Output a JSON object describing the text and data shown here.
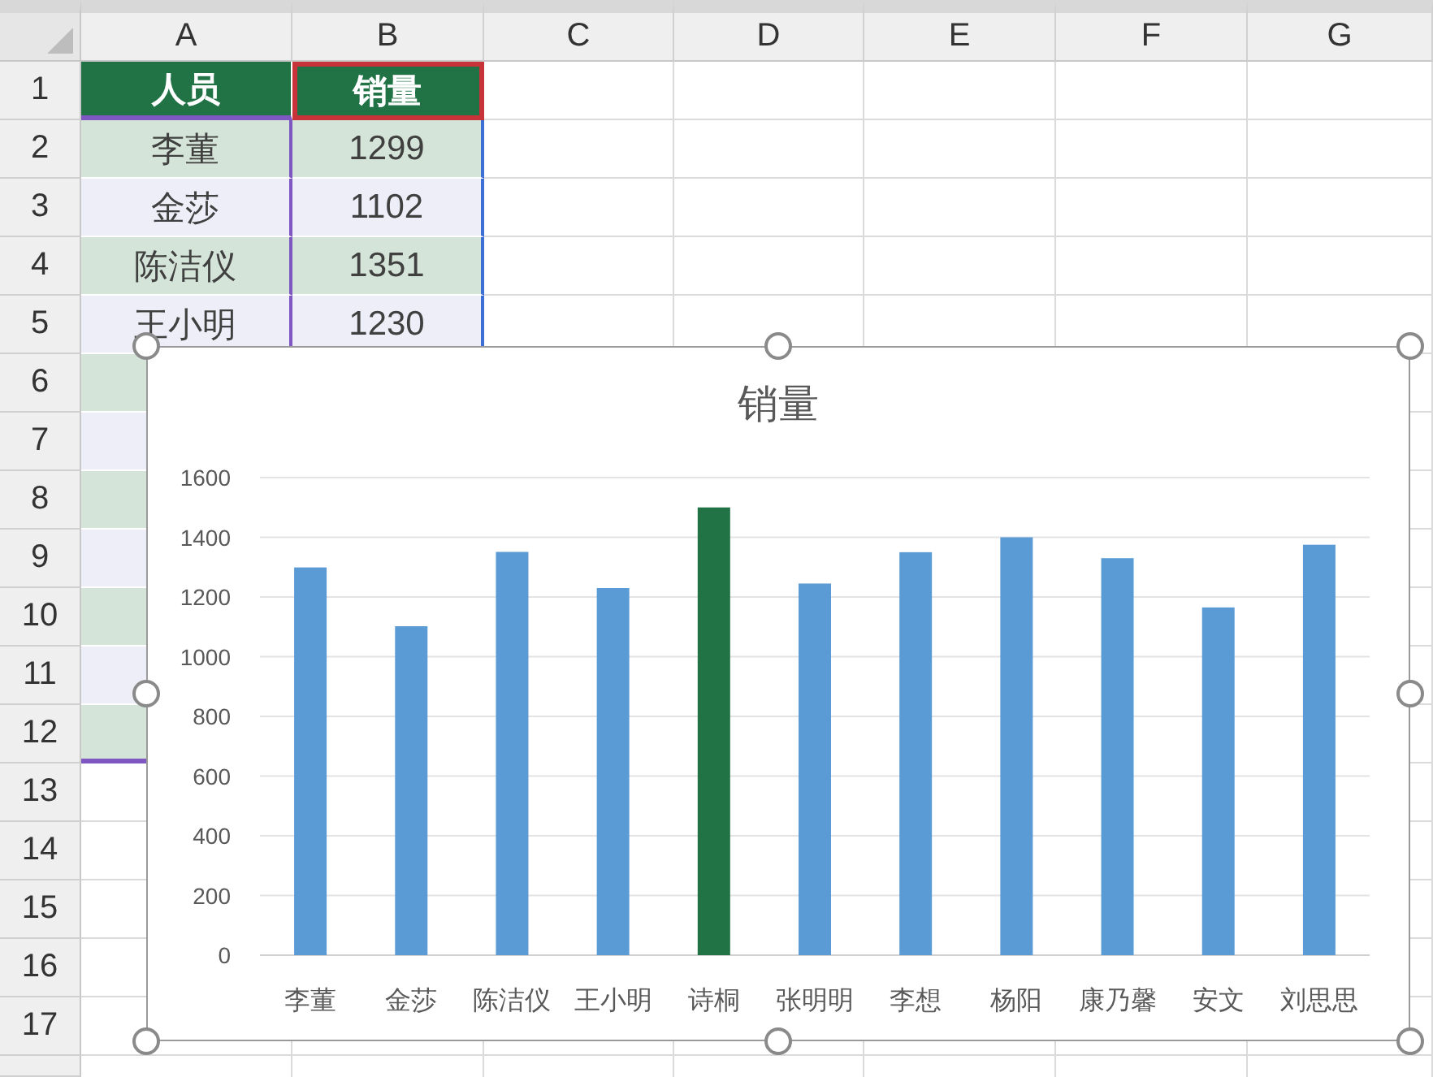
{
  "columns": [
    "A",
    "B",
    "C",
    "D",
    "E",
    "F",
    "G"
  ],
  "row_numbers": [
    "1",
    "2",
    "3",
    "4",
    "5",
    "6",
    "7",
    "8",
    "9",
    "10",
    "11",
    "12",
    "13",
    "14",
    "15",
    "16",
    "17"
  ],
  "table": {
    "header": [
      "人员",
      "销量"
    ],
    "rows": [
      {
        "name": "李董",
        "sales": "1299"
      },
      {
        "name": "金莎",
        "sales": "1102"
      },
      {
        "name": "陈洁仪",
        "sales": "1351"
      },
      {
        "name": "王小明",
        "sales": "1230"
      }
    ]
  },
  "chart": {
    "chart_data": {
      "type": "bar",
      "title": "销量",
      "categories": [
        "李董",
        "金莎",
        "陈洁仪",
        "王小明",
        "诗桐",
        "张明明",
        "李想",
        "杨阳",
        "康乃馨",
        "安文",
        "刘思思"
      ],
      "values": [
        1299,
        1102,
        1351,
        1230,
        1500,
        1245,
        1350,
        1400,
        1330,
        1165,
        1375
      ],
      "ylim": [
        0,
        1600
      ],
      "yticks": [
        0,
        200,
        400,
        600,
        800,
        1000,
        1200,
        1400,
        1600
      ],
      "grid": true
    },
    "bars": [
      {
        "highlighted": false
      },
      {
        "highlighted": false
      },
      {
        "highlighted": false
      },
      {
        "highlighted": false
      },
      {
        "highlighted": true
      },
      {
        "highlighted": false
      },
      {
        "highlighted": false
      },
      {
        "highlighted": false
      },
      {
        "highlighted": false
      },
      {
        "highlighted": false
      },
      {
        "highlighted": false
      }
    ]
  }
}
